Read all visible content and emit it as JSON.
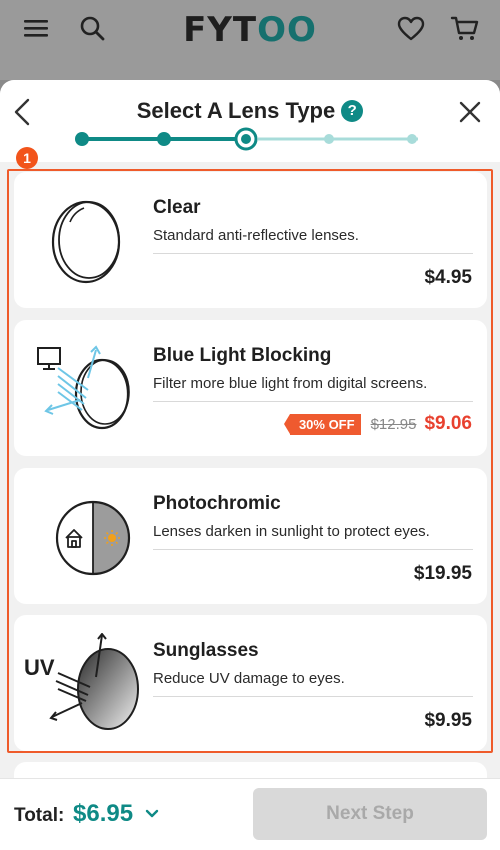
{
  "app": {
    "logo_prefix": "FYT",
    "logo_suffix": "OO"
  },
  "sheet": {
    "title": "Select A Lens Type",
    "help_glyph": "?",
    "steps_total": 5,
    "current_step": 3
  },
  "annotation": {
    "badge": "1"
  },
  "lens_options": [
    {
      "name": "Clear",
      "description": "Standard anti-reflective lenses.",
      "price": "$4.95",
      "icon": "clear-lens-icon"
    },
    {
      "name": "Blue Light Blocking",
      "description": "Filter more blue light from digital screens.",
      "discount": "30% OFF",
      "original_price": "$12.95",
      "sale_price": "$9.06",
      "icon": "blue-light-lens-icon"
    },
    {
      "name": "Photochromic",
      "description": "Lenses darken in sunlight to protect eyes.",
      "price": "$19.95",
      "icon": "photochromic-lens-icon"
    },
    {
      "name": "Sunglasses",
      "description": "Reduce UV damage to eyes.",
      "price": "$9.95",
      "icon": "sunglasses-lens-icon",
      "icon_label": "UV"
    }
  ],
  "footer": {
    "total_label": "Total:",
    "total_value": "$6.95",
    "next_button": "Next Step"
  },
  "colors": {
    "brand_teal": "#0f8a86",
    "accent_orange": "#ef5a2f",
    "sale_red": "#e8412f",
    "disabled_button": "#d9d9d9"
  }
}
